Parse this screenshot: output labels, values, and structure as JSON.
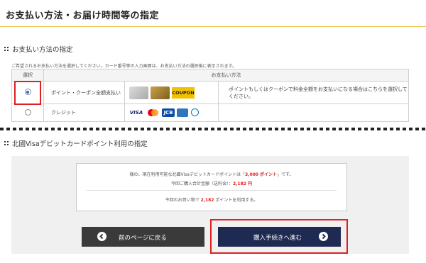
{
  "page_title": "お支払い方法・お届け時間等の指定",
  "payment_section": {
    "heading": "お支払い方法の指定",
    "note": "ご希望されるお支払い方法を選択してください。カード番号等の入力画面は、お支払い方法の選択後に表示されます。",
    "table_headers": {
      "select": "選択",
      "method": "お支払い方法"
    },
    "rows": [
      {
        "label": "ポイント・クーポン全額支払い",
        "selected": true,
        "logos": [
          "card-silver-icon",
          "card-gold-icon",
          "card-black-icon",
          "coupon-icon"
        ],
        "coupon_text": "COUPON",
        "description": "ポイントもしくはクーポンで料金全額をお支払いになる場合はこちらを選択してください。"
      },
      {
        "label": "クレジット",
        "selected": false,
        "logos": [
          "visa-icon",
          "mastercard-icon",
          "jcb-icon",
          "amex-icon",
          "diners-icon"
        ],
        "brand_visa": "VISA",
        "brand_jcb": "JCB",
        "description": ""
      }
    ]
  },
  "points_section": {
    "heading": "北國Visaデビットカードポイント利用の指定",
    "line1_prefix": "様の、現在利用可能な北國Visaデビットカードポイントは「",
    "line1_points": "3,000 ポイント",
    "line1_suffix": "」です。",
    "line2_prefix": "今回ご購入合計金額（送料含）：",
    "line2_amount": "2,182 円",
    "line3_prefix": "今回のお買い物で",
    "line3_points": "2,182",
    "line3_suffix": "ポイントを利用する。"
  },
  "buttons": {
    "back": "前のページに戻る",
    "next": "購入手続きへ進む"
  },
  "colors": {
    "accent_yellow": "#e8c34a",
    "highlight_red": "#e02020",
    "next_button": "#1f2a52",
    "back_button": "#3a3a3a"
  }
}
